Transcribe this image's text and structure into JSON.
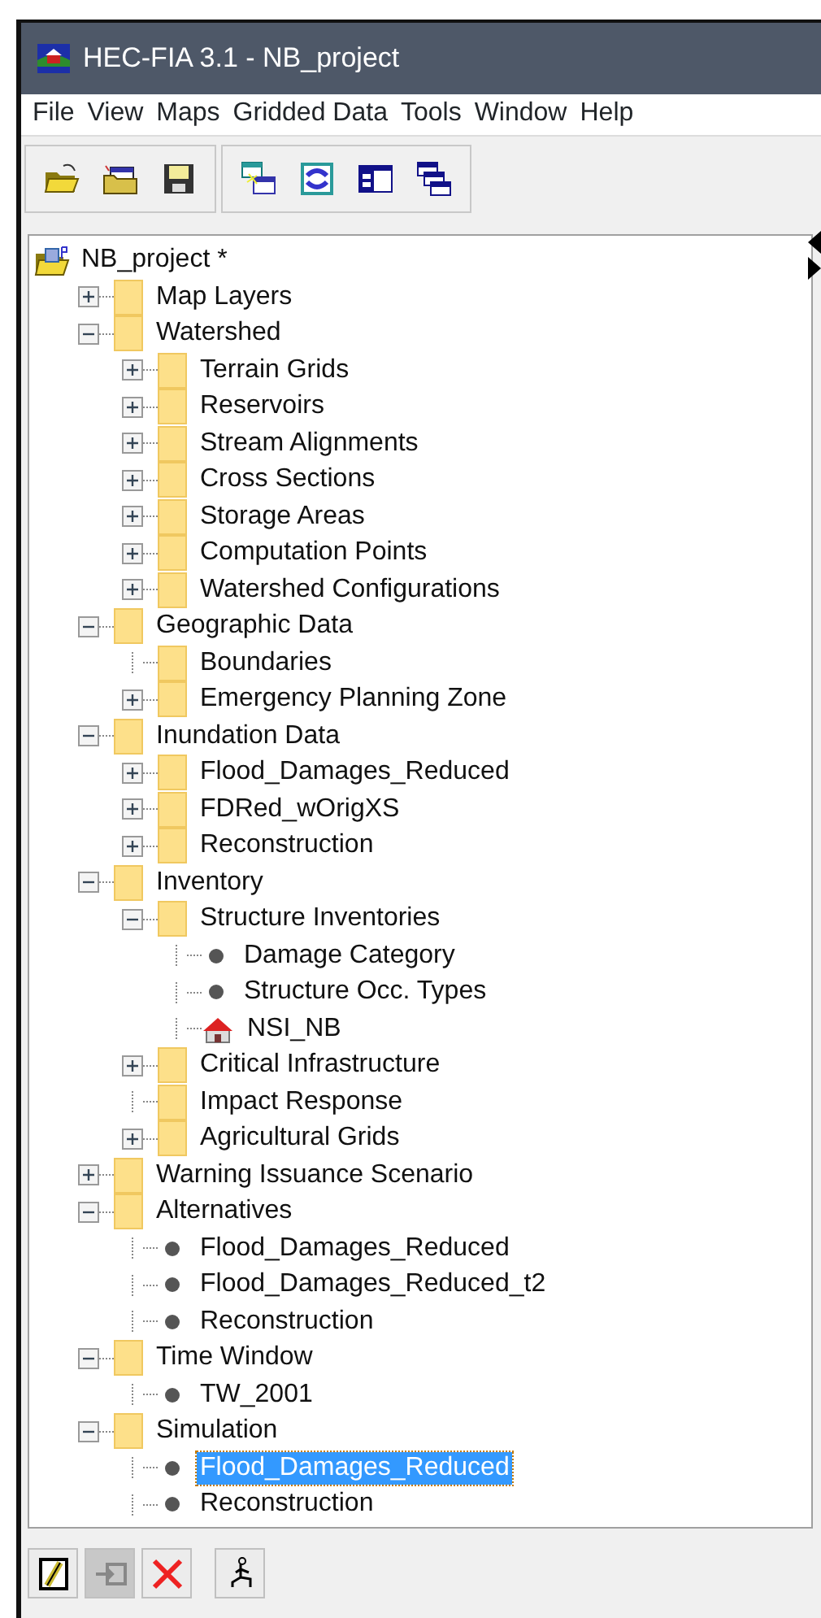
{
  "window": {
    "title": "HEC-FIA 3.1 - NB_project"
  },
  "menu": [
    "File",
    "View",
    "Maps",
    "Gridded Data",
    "Tools",
    "Window",
    "Help"
  ],
  "toolbar": [
    {
      "kind": "open"
    },
    {
      "kind": "open-recent"
    },
    {
      "kind": "save"
    },
    {
      "kind": "window-link"
    },
    {
      "kind": "window-sync"
    },
    {
      "kind": "tile"
    },
    {
      "kind": "cascade"
    }
  ],
  "tree": {
    "label": "NB_project *",
    "children": [
      {
        "label": "Map Layers",
        "kind": "folder",
        "expanded": false
      },
      {
        "label": "Watershed",
        "kind": "folder",
        "expanded": true,
        "children": [
          {
            "label": "Terrain Grids",
            "kind": "folder",
            "expanded": false
          },
          {
            "label": "Reservoirs",
            "kind": "folder",
            "expanded": false
          },
          {
            "label": "Stream Alignments",
            "kind": "folder",
            "expanded": false
          },
          {
            "label": "Cross Sections",
            "kind": "folder",
            "expanded": false
          },
          {
            "label": "Storage Areas",
            "kind": "folder",
            "expanded": false
          },
          {
            "label": "Computation Points",
            "kind": "folder",
            "expanded": false
          },
          {
            "label": "Watershed Configurations",
            "kind": "folder",
            "expanded": false
          }
        ]
      },
      {
        "label": "Geographic Data",
        "kind": "folder",
        "expanded": true,
        "children": [
          {
            "label": "Boundaries",
            "kind": "folder"
          },
          {
            "label": "Emergency Planning Zone",
            "kind": "folder",
            "expanded": false
          }
        ]
      },
      {
        "label": "Inundation Data",
        "kind": "folder",
        "expanded": true,
        "children": [
          {
            "label": "Flood_Damages_Reduced",
            "kind": "folder",
            "expanded": false
          },
          {
            "label": "FDRed_wOrigXS",
            "kind": "folder",
            "expanded": false
          },
          {
            "label": "Reconstruction",
            "kind": "folder",
            "expanded": false
          }
        ]
      },
      {
        "label": "Inventory",
        "kind": "folder",
        "expanded": true,
        "children": [
          {
            "label": "Structure Inventories",
            "kind": "folder",
            "expanded": true,
            "children": [
              {
                "label": "Damage Category",
                "kind": "item"
              },
              {
                "label": "Structure Occ. Types",
                "kind": "item"
              },
              {
                "label": "NSI_NB",
                "kind": "structure"
              }
            ]
          },
          {
            "label": "Critical Infrastructure",
            "kind": "folder",
            "expanded": false
          },
          {
            "label": "Impact Response",
            "kind": "folder"
          },
          {
            "label": "Agricultural Grids",
            "kind": "folder",
            "expanded": false
          }
        ]
      },
      {
        "label": "Warning Issuance Scenario",
        "kind": "folder",
        "expanded": false
      },
      {
        "label": "Alternatives",
        "kind": "folder",
        "expanded": true,
        "children": [
          {
            "label": "Flood_Damages_Reduced",
            "kind": "item"
          },
          {
            "label": "Flood_Damages_Reduced_t2",
            "kind": "item"
          },
          {
            "label": "Reconstruction",
            "kind": "item"
          }
        ]
      },
      {
        "label": "Time Window",
        "kind": "folder",
        "expanded": true,
        "children": [
          {
            "label": "TW_2001",
            "kind": "item"
          }
        ]
      },
      {
        "label": "Simulation",
        "kind": "folder",
        "expanded": true,
        "children": [
          {
            "label": "Flood_Damages_Reduced",
            "kind": "item",
            "selected": true
          },
          {
            "label": "Reconstruction",
            "kind": "item",
            "selected": false
          }
        ]
      }
    ]
  },
  "bottom_buttons": [
    {
      "kind": "edit",
      "disabled": false
    },
    {
      "kind": "import",
      "disabled": true
    },
    {
      "kind": "delete",
      "disabled": false
    },
    {
      "kind": "run",
      "disabled": false
    }
  ]
}
